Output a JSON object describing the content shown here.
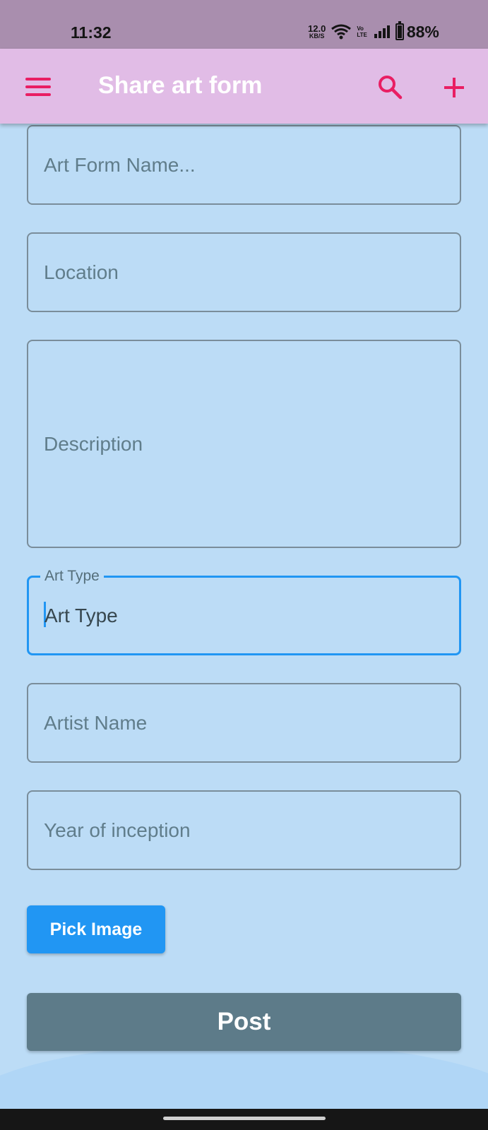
{
  "status_bar": {
    "time": "11:32",
    "net_speed_value": "12.0",
    "net_speed_unit": "KB/S",
    "volte_top": "Vo",
    "volte_bottom": "LTE",
    "battery_level": 0.88,
    "battery_percent": "88%"
  },
  "app_bar": {
    "title": "Share art form",
    "background": "#e1bce6",
    "icon_color": "#e91e63"
  },
  "form": {
    "art_form_name_placeholder": "Art Form Name...",
    "location_placeholder": "Location",
    "description_placeholder": "Description",
    "art_type_label": "Art Type",
    "art_type_value": "Art Type",
    "artist_name_placeholder": "Artist Name",
    "year_placeholder": "Year of inception"
  },
  "buttons": {
    "pick_image_label": "Pick Image",
    "post_label": "Post"
  },
  "colors": {
    "background": "#bcdcf6",
    "focus_accent": "#2196f3",
    "post_button": "#5d7b89"
  }
}
